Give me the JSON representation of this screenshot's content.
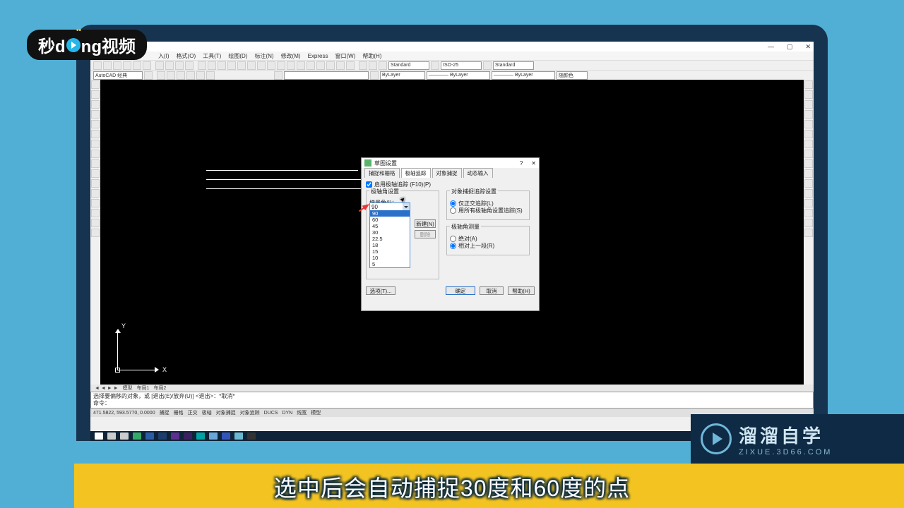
{
  "domain": "Computer-Use",
  "app": {
    "name": "AutoCAD"
  },
  "window_controls": {
    "min": "—",
    "max": "▢",
    "close": "✕"
  },
  "menubar": [
    "入(I)",
    "格式(O)",
    "工具(T)",
    "绘图(D)",
    "标注(N)",
    "修改(M)",
    "Express",
    "窗口(W)",
    "帮助(H)"
  ],
  "toolbar2": {
    "workspace": "AutoCAD 经典",
    "style1": "Standard",
    "style2": "ISO-25",
    "style3": "Standard"
  },
  "toolbar3": {
    "layer": "",
    "linetype1": "ByLayer",
    "linetype2": "———— ByLayer",
    "linetype3": "———— ByLayer",
    "color": "随颜色"
  },
  "axis": {
    "x": "X",
    "y": "Y"
  },
  "tabs": {
    "layout_nav": "◄ ◄ ► ►",
    "model": "模型",
    "layout1": "布局1",
    "layout2": "布局2"
  },
  "cmd": {
    "line1": "选择要偏移的对象，或 [退出(E)/放弃(U)] <退出>：*取消*",
    "line2": "命令："
  },
  "status": {
    "coords": "471.5822, 593.5770, 0.0000",
    "items": [
      "捕捉",
      "栅格",
      "正交",
      "极轴",
      "对象捕捉",
      "对象追踪",
      "DUCS",
      "DYN",
      "线宽",
      "模型"
    ]
  },
  "dialog": {
    "title": "草图设置",
    "help": "?",
    "close": "✕",
    "tabs": [
      "捕捉和栅格",
      "极轴追踪",
      "对象捕捉",
      "动态输入"
    ],
    "active_tab": 1,
    "enable": "启用极轴追踪 (F10)(P)",
    "group_left": "极轴角设置",
    "incr_label": "增量角(I)：",
    "incr_value": "90",
    "incr_options": [
      "90",
      "60",
      "45",
      "30",
      "22.5",
      "18",
      "15",
      "10",
      "5"
    ],
    "highlight_index": 0,
    "new_btn": "新建(N)",
    "del_btn": "删除",
    "group_r1": "对象捕捉追踪设置",
    "r1_opt1": "仅正交追踪(L)",
    "r1_opt2": "用所有极轴角设置追踪(S)",
    "group_r2": "极轴角测量",
    "r2_opt1": "绝对(A)",
    "r2_opt2": "相对上一段(R)",
    "options": "选项(T)...",
    "ok": "确定",
    "cancel": "取消",
    "helpb": "帮助(H)"
  },
  "subtitle": "选中后会自动捕捉30度和60度的点",
  "brand_tl": {
    "a": "秒d",
    "b": "ng视频"
  },
  "brand_br": {
    "big": "溜溜自学",
    "small": "ZIXUE.3D66.COM"
  }
}
